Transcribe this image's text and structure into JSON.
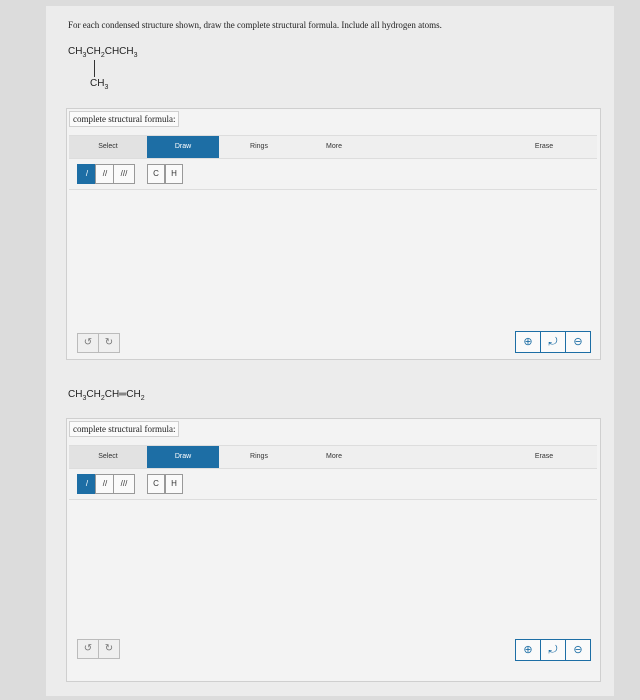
{
  "instructions": "For each condensed structure shown, draw the complete structural formula. Include all hydrogen atoms.",
  "structure1": {
    "main": "CH3CH2CHCH3",
    "branch": "CH3"
  },
  "structure2": {
    "formula": "CH3CH2CH═CH2"
  },
  "panels": [
    {
      "title": "complete structural formula:",
      "tabs": {
        "select": "Select",
        "draw": "Draw",
        "rings": "Rings",
        "more": "More",
        "erase": "Erase"
      },
      "tools": {
        "single": "/",
        "double": "//",
        "triple": "///",
        "carbon": "C",
        "hydrogen": "H"
      },
      "icons": {
        "undo": "↺",
        "redo": "↻",
        "zoom_in": "⊕",
        "zoom_reset": "⤾",
        "zoom_out": "⊖"
      }
    },
    {
      "title": "complete structural formula:",
      "tabs": {
        "select": "Select",
        "draw": "Draw",
        "rings": "Rings",
        "more": "More",
        "erase": "Erase"
      },
      "tools": {
        "single": "/",
        "double": "//",
        "triple": "///",
        "carbon": "C",
        "hydrogen": "H"
      },
      "icons": {
        "undo": "↺",
        "redo": "↻",
        "zoom_in": "⊕",
        "zoom_reset": "⤾",
        "zoom_out": "⊖"
      }
    }
  ],
  "colors": {
    "accent": "#1d6ea5",
    "panel_bg": "#f3f3f3",
    "page_bg": "#ececec"
  }
}
